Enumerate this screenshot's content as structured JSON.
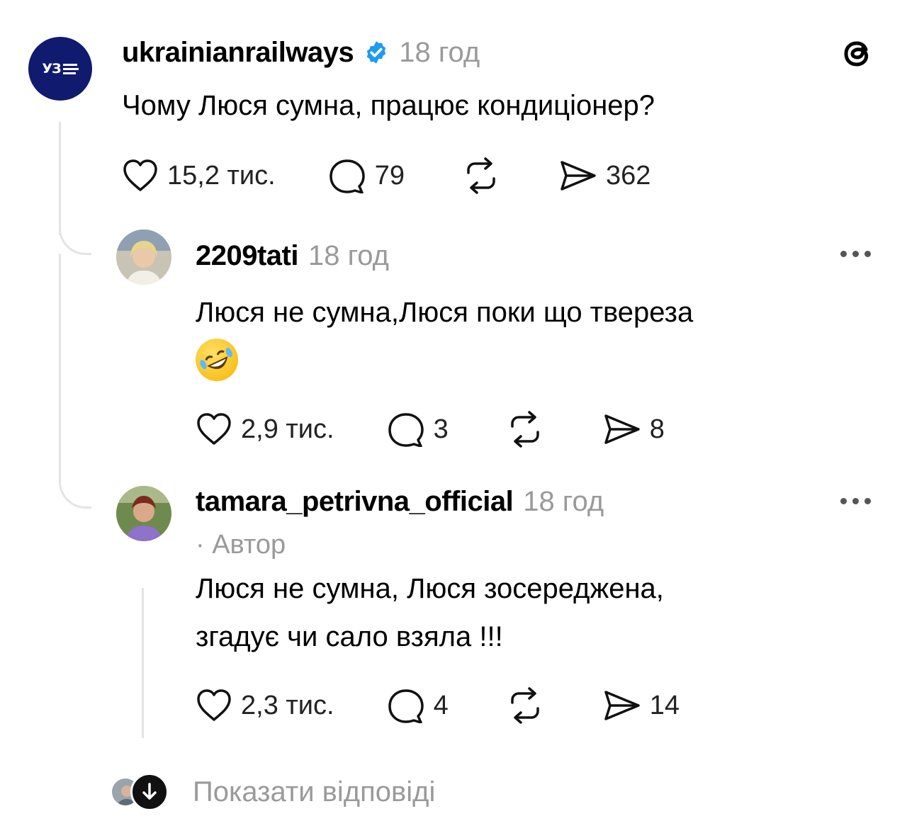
{
  "post": {
    "username": "ukrainianrailways",
    "time": "18 год",
    "text": "Чому Люся сумна, працює кондиціонер?",
    "likes": "15,2 тис.",
    "comments": "79",
    "shares": "362",
    "avatar_logo": "УЗ"
  },
  "replies": [
    {
      "username": "2209tati",
      "time": "18 год",
      "text_line1": "Люся не сумна,Люся поки що твереза",
      "emoji": "rolling-on-floor-laughing",
      "likes": "2,9 тис.",
      "comments": "3",
      "shares": "8"
    },
    {
      "username": "tamara_petrivna_official",
      "time": "18 год",
      "author_tag": "· Автор",
      "text_line1": "Люся не сумна, Люся зосереджена,",
      "text_line2": "згадує чи сало взяла !!!",
      "likes": "2,3 тис.",
      "comments": "4",
      "shares": "14"
    }
  ],
  "footer": {
    "show_replies": "Показати відповіді"
  },
  "icons": {
    "app_logo": "threads-logo-icon",
    "verified": "verified-badge-icon",
    "like": "heart-icon",
    "comment": "comment-bubble-icon",
    "repost": "repost-icon",
    "share": "send-icon",
    "more": "more-dots-icon",
    "expand": "arrow-down-icon"
  },
  "colors": {
    "verified_blue": "#1d9bf0",
    "avatar_navy": "#101a6e",
    "muted_text": "#9a9a9a",
    "thread_line": "#e4e4e4"
  }
}
